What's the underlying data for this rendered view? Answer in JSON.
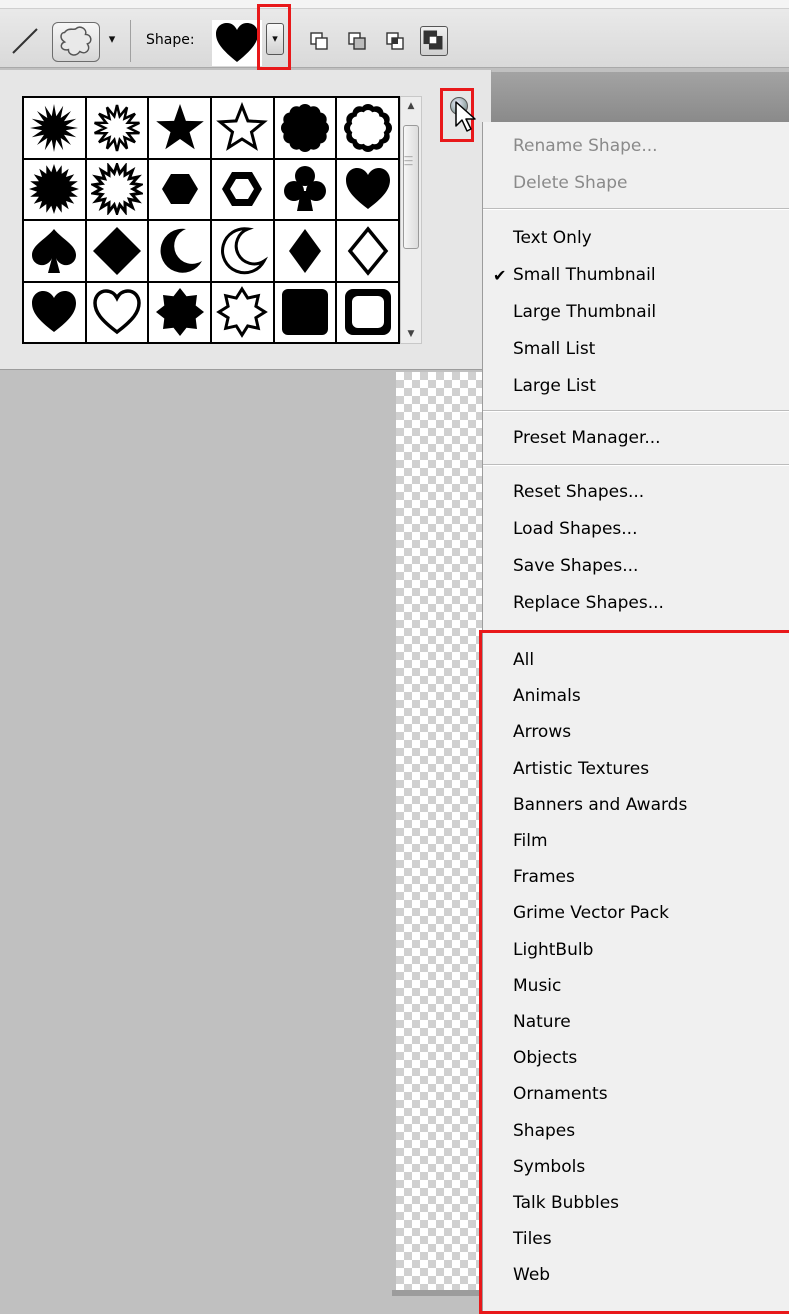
{
  "options_bar": {
    "shape_label": "Shape:",
    "tool_caret": "▾",
    "dd_arrow": "▾"
  },
  "picker": {
    "shapes": [
      "starburst-icon",
      "starburst-outline-icon",
      "star-icon",
      "star-outline-icon",
      "scallop-icon",
      "scallop-outline-icon",
      "seal-icon",
      "seal-outline-icon",
      "hexagon-icon",
      "hexagon-outline-icon",
      "club-icon",
      "heart-icon",
      "spade-icon",
      "diamond-icon",
      "crescent-icon",
      "crescent-outline-icon",
      "diamond-small-icon",
      "diamond-outline-icon",
      "heart-icon",
      "heart-outline-icon",
      "octagram-icon",
      "octagram-outline-icon",
      "rounded-square-icon",
      "rounded-square-outline-icon"
    ]
  },
  "menu": {
    "items": [
      {
        "label": "Rename Shape...",
        "disabled": true
      },
      {
        "label": "Delete Shape",
        "disabled": true
      }
    ],
    "view_items": [
      {
        "label": "Text Only",
        "checked": false
      },
      {
        "label": "Small Thumbnail",
        "checked": true
      },
      {
        "label": "Large Thumbnail",
        "checked": false
      },
      {
        "label": "Small List",
        "checked": false
      },
      {
        "label": "Large List",
        "checked": false
      }
    ],
    "preset_manager": "Preset Manager...",
    "file_items": [
      "Reset Shapes...",
      "Load Shapes...",
      "Save Shapes...",
      "Replace Shapes..."
    ],
    "libraries": [
      "All",
      "Animals",
      "Arrows",
      "Artistic Textures",
      "Banners and Awards",
      "Film",
      "Frames",
      "Grime Vector Pack",
      "LightBulb",
      "Music",
      "Nature",
      "Objects",
      "Ornaments",
      "Shapes",
      "Symbols",
      "Talk Bubbles",
      "Tiles",
      "Web"
    ],
    "check_mark": "✔"
  },
  "colors": {
    "highlight": "#e8181a"
  }
}
